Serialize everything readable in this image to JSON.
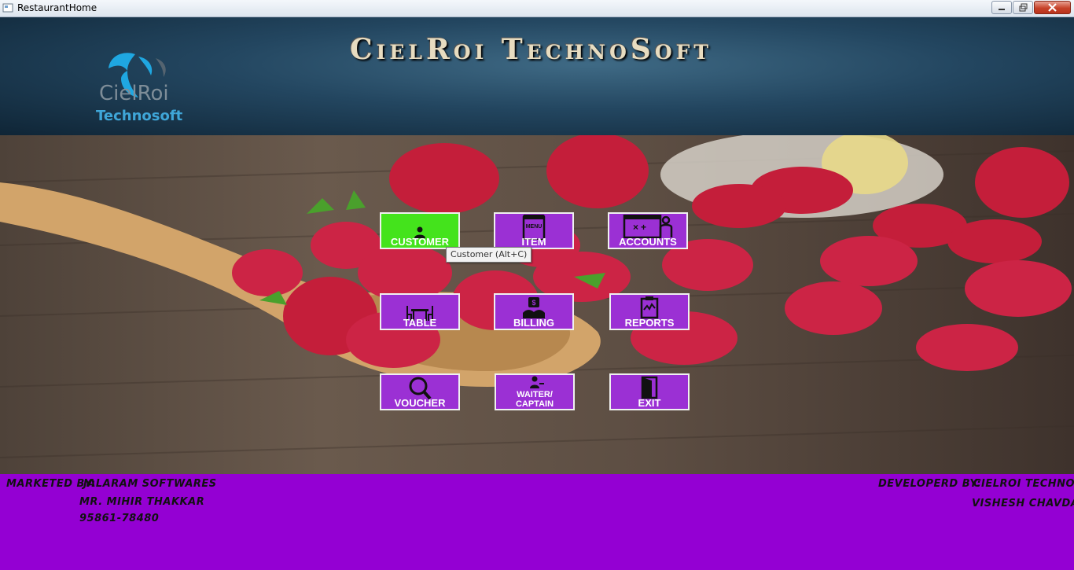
{
  "window": {
    "title": "RestaurantHome"
  },
  "header": {
    "brand": "CielRoi TechnoSoft",
    "logo_word1": "CielRoi",
    "logo_word2": "Technosoft"
  },
  "menu": {
    "customer": "CUSTOMER",
    "item": "ITEM",
    "item_icon_text": "MENU",
    "accounts": "ACCOUNTS",
    "table": "TABLE",
    "billing": "BILLING",
    "reports": "REPORTS",
    "voucher": "VOUCHER",
    "waiter_line1": "WAITER/",
    "waiter_line2": "CAPTAIN",
    "exit": "EXIT"
  },
  "tooltip": "Customer (Alt+C)",
  "footer": {
    "marketed_label": "Marketed By:",
    "marketed_company": "Jalaram Softwares",
    "marketed_person": "Mr. Mihir Thakkar",
    "marketed_phone": "95861-78480",
    "developed_label": "Developerd By:",
    "developed_company": "CielRoi Technosoft",
    "developed_person": "Vishesh Chavda"
  },
  "colors": {
    "footer": "#9400d3",
    "button": "#9b30d4",
    "button_active": "#44e31c"
  }
}
